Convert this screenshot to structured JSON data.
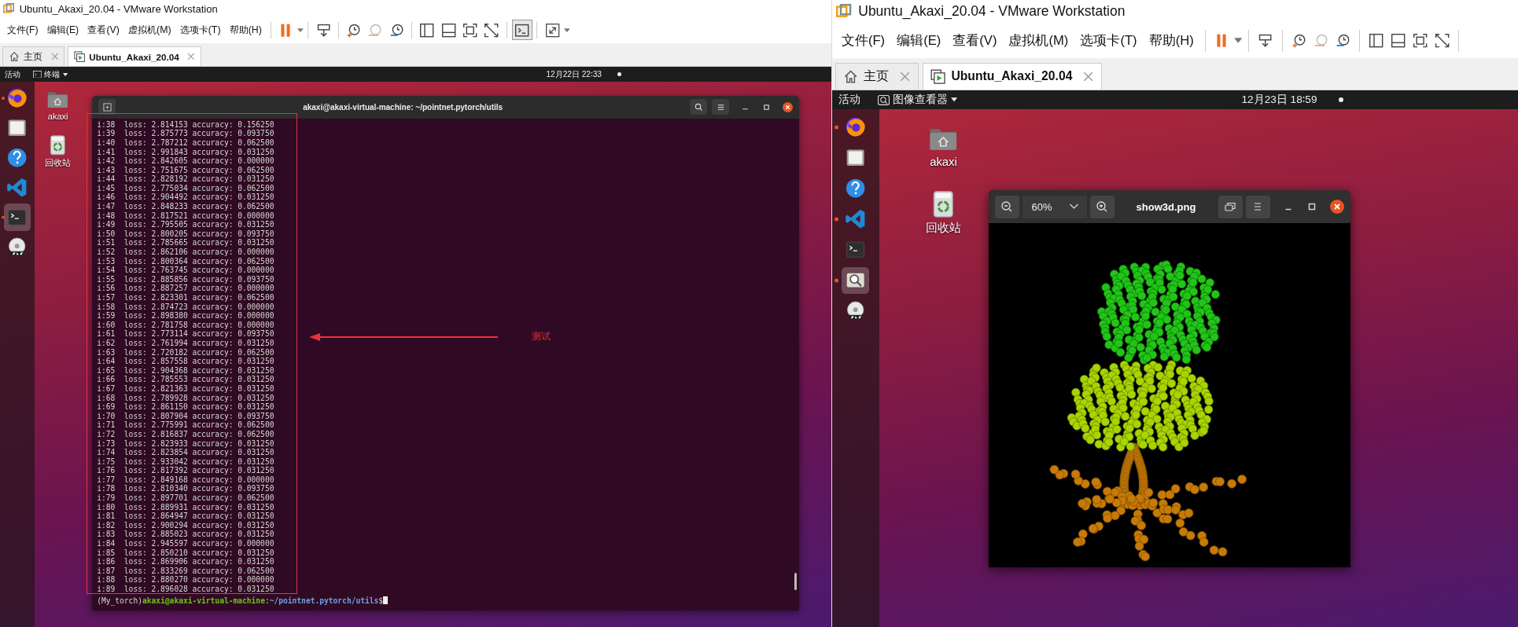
{
  "windows": [
    {
      "title": "Ubuntu_Akaxi_20.04 - VMware Workstation",
      "menu": [
        "文件(F)",
        "编辑(E)",
        "查看(V)",
        "虚拟机(M)",
        "选项卡(T)",
        "帮助(H)"
      ],
      "toolbar": [
        {
          "kind": "pause",
          "selected": false
        },
        {
          "kind": "send-keys",
          "selected": false
        },
        {
          "kind": "snapshot-take",
          "selected": false
        },
        {
          "kind": "snapshot-revert",
          "selected": false
        },
        {
          "kind": "snapshot-manage",
          "selected": false
        },
        {
          "kind": "view-library",
          "selected": false
        },
        {
          "kind": "view-thumbs",
          "selected": false
        },
        {
          "kind": "view-fit",
          "selected": false
        },
        {
          "kind": "view-noscale",
          "selected": false
        },
        {
          "kind": "console",
          "selected": true
        },
        {
          "kind": "fullscreen",
          "selected": false
        }
      ],
      "tabs": [
        {
          "kind": "home",
          "label": "主页",
          "selected": false
        },
        {
          "kind": "vm",
          "label": "Ubuntu_Akaxi_20.04",
          "selected": true
        }
      ],
      "top_bar": {
        "activities": "活动",
        "app_menu": {
          "kind": "terminal",
          "label": "终端"
        },
        "clock": "12月22日 22∶33"
      },
      "dock": [
        {
          "kind": "browser",
          "running": true,
          "selected": false
        },
        {
          "kind": "files",
          "running": false,
          "selected": false
        },
        {
          "kind": "help",
          "running": false,
          "selected": false
        },
        {
          "kind": "code",
          "running": false,
          "selected": false
        },
        {
          "kind": "terminal",
          "running": true,
          "selected": true
        },
        {
          "kind": "dvd",
          "running": false,
          "selected": false
        }
      ],
      "desktop_icons": [
        {
          "kind": "home-folder",
          "label": "akaxi"
        },
        {
          "kind": "trash",
          "label": "回收站"
        }
      ],
      "app": {
        "kind": "terminal",
        "title": "akaxi@akaxi-virtual-machine: ~/pointnet.pytorch/utils",
        "lines": [
          "i:38  loss: 2.814153 accuracy: 0.156250",
          "i:39  loss: 2.875773 accuracy: 0.093750",
          "i:40  loss: 2.787212 accuracy: 0.062500",
          "i:41  loss: 2.991843 accuracy: 0.031250",
          "i:42  loss: 2.842605 accuracy: 0.000000",
          "i:43  loss: 2.751675 accuracy: 0.062500",
          "i:44  loss: 2.828192 accuracy: 0.031250",
          "i:45  loss: 2.775034 accuracy: 0.062500",
          "i:46  loss: 2.904492 accuracy: 0.031250",
          "i:47  loss: 2.848233 accuracy: 0.062500",
          "i:48  loss: 2.817521 accuracy: 0.000000",
          "i:49  loss: 2.795505 accuracy: 0.031250",
          "i:50  loss: 2.800205 accuracy: 0.093750",
          "i:51  loss: 2.785665 accuracy: 0.031250",
          "i:52  loss: 2.862106 accuracy: 0.000000",
          "i:53  loss: 2.800364 accuracy: 0.062500",
          "i:54  loss: 2.763745 accuracy: 0.000000",
          "i:55  loss: 2.885856 accuracy: 0.093750",
          "i:56  loss: 2.887257 accuracy: 0.000000",
          "i:57  loss: 2.823301 accuracy: 0.062500",
          "i:58  loss: 2.874723 accuracy: 0.000000",
          "i:59  loss: 2.898380 accuracy: 0.000000",
          "i:60  loss: 2.781758 accuracy: 0.000000",
          "i:61  loss: 2.773114 accuracy: 0.093750",
          "i:62  loss: 2.761994 accuracy: 0.031250",
          "i:63  loss: 2.720182 accuracy: 0.062500",
          "i:64  loss: 2.857558 accuracy: 0.031250",
          "i:65  loss: 2.904368 accuracy: 0.031250",
          "i:66  loss: 2.785553 accuracy: 0.031250",
          "i:67  loss: 2.821363 accuracy: 0.031250",
          "i:68  loss: 2.789928 accuracy: 0.031250",
          "i:69  loss: 2.861150 accuracy: 0.031250",
          "i:70  loss: 2.807904 accuracy: 0.093750",
          "i:71  loss: 2.775991 accuracy: 0.062500",
          "i:72  loss: 2.816837 accuracy: 0.062500",
          "i:73  loss: 2.823933 accuracy: 0.031250",
          "i:74  loss: 2.823854 accuracy: 0.031250",
          "i:75  loss: 2.933042 accuracy: 0.031250",
          "i:76  loss: 2.817392 accuracy: 0.031250",
          "i:77  loss: 2.849168 accuracy: 0.000000",
          "i:78  loss: 2.810340 accuracy: 0.093750",
          "i:79  loss: 2.897701 accuracy: 0.062500",
          "i:80  loss: 2.889931 accuracy: 0.031250",
          "i:81  loss: 2.864947 accuracy: 0.031250",
          "i:82  loss: 2.900294 accuracy: 0.031250",
          "i:83  loss: 2.885023 accuracy: 0.031250",
          "i:84  loss: 2.945597 accuracy: 0.000000",
          "i:85  loss: 2.850210 accuracy: 0.031250",
          "i:86  loss: 2.869906 accuracy: 0.031250",
          "i:87  loss: 2.833269 accuracy: 0.062500",
          "i:88  loss: 2.880270 accuracy: 0.000000",
          "i:89  loss: 2.896028 accuracy: 0.031250"
        ],
        "prompt": {
          "env": "(My_torch)",
          "user_host": "akaxi@akaxi-virtual-machine",
          "separator": ":",
          "path": "~/pointnet.pytorch/utils",
          "symbol": "$"
        },
        "annotation": {
          "label": "测试"
        }
      }
    },
    {
      "title": "Ubuntu_Akaxi_20.04 - VMware Workstation",
      "menu": [
        "文件(F)",
        "编辑(E)",
        "查看(V)",
        "虚拟机(M)",
        "选项卡(T)",
        "帮助(H)"
      ],
      "toolbar": [
        {
          "kind": "pause",
          "selected": false
        },
        {
          "kind": "send-keys",
          "selected": false
        },
        {
          "kind": "snapshot-take",
          "selected": false
        },
        {
          "kind": "snapshot-revert",
          "selected": false
        },
        {
          "kind": "snapshot-manage",
          "selected": false
        },
        {
          "kind": "view-library",
          "selected": false
        },
        {
          "kind": "view-thumbs",
          "selected": false
        },
        {
          "kind": "view-fit",
          "selected": false
        },
        {
          "kind": "view-noscale",
          "selected": false
        }
      ],
      "tabs": [
        {
          "kind": "home",
          "label": "主页",
          "selected": false
        },
        {
          "kind": "vm",
          "label": "Ubuntu_Akaxi_20.04",
          "selected": true
        }
      ],
      "top_bar": {
        "activities": "活动",
        "app_menu": {
          "kind": "viewer",
          "label": "图像查看器"
        },
        "clock": "12月23日 18∶59"
      },
      "dock": [
        {
          "kind": "browser",
          "running": true,
          "selected": false
        },
        {
          "kind": "files",
          "running": false,
          "selected": false
        },
        {
          "kind": "help",
          "running": false,
          "selected": false
        },
        {
          "kind": "code",
          "running": true,
          "selected": false
        },
        {
          "kind": "terminal",
          "running": false,
          "selected": false
        },
        {
          "kind": "viewer",
          "running": true,
          "selected": true
        },
        {
          "kind": "dvd",
          "running": false,
          "selected": false
        }
      ],
      "desktop_icons": [
        {
          "kind": "home-folder",
          "label": "akaxi"
        },
        {
          "kind": "trash",
          "label": "回收站"
        }
      ],
      "app": {
        "kind": "image_viewer",
        "zoom": "60%",
        "title": "show3d.png"
      }
    }
  ]
}
